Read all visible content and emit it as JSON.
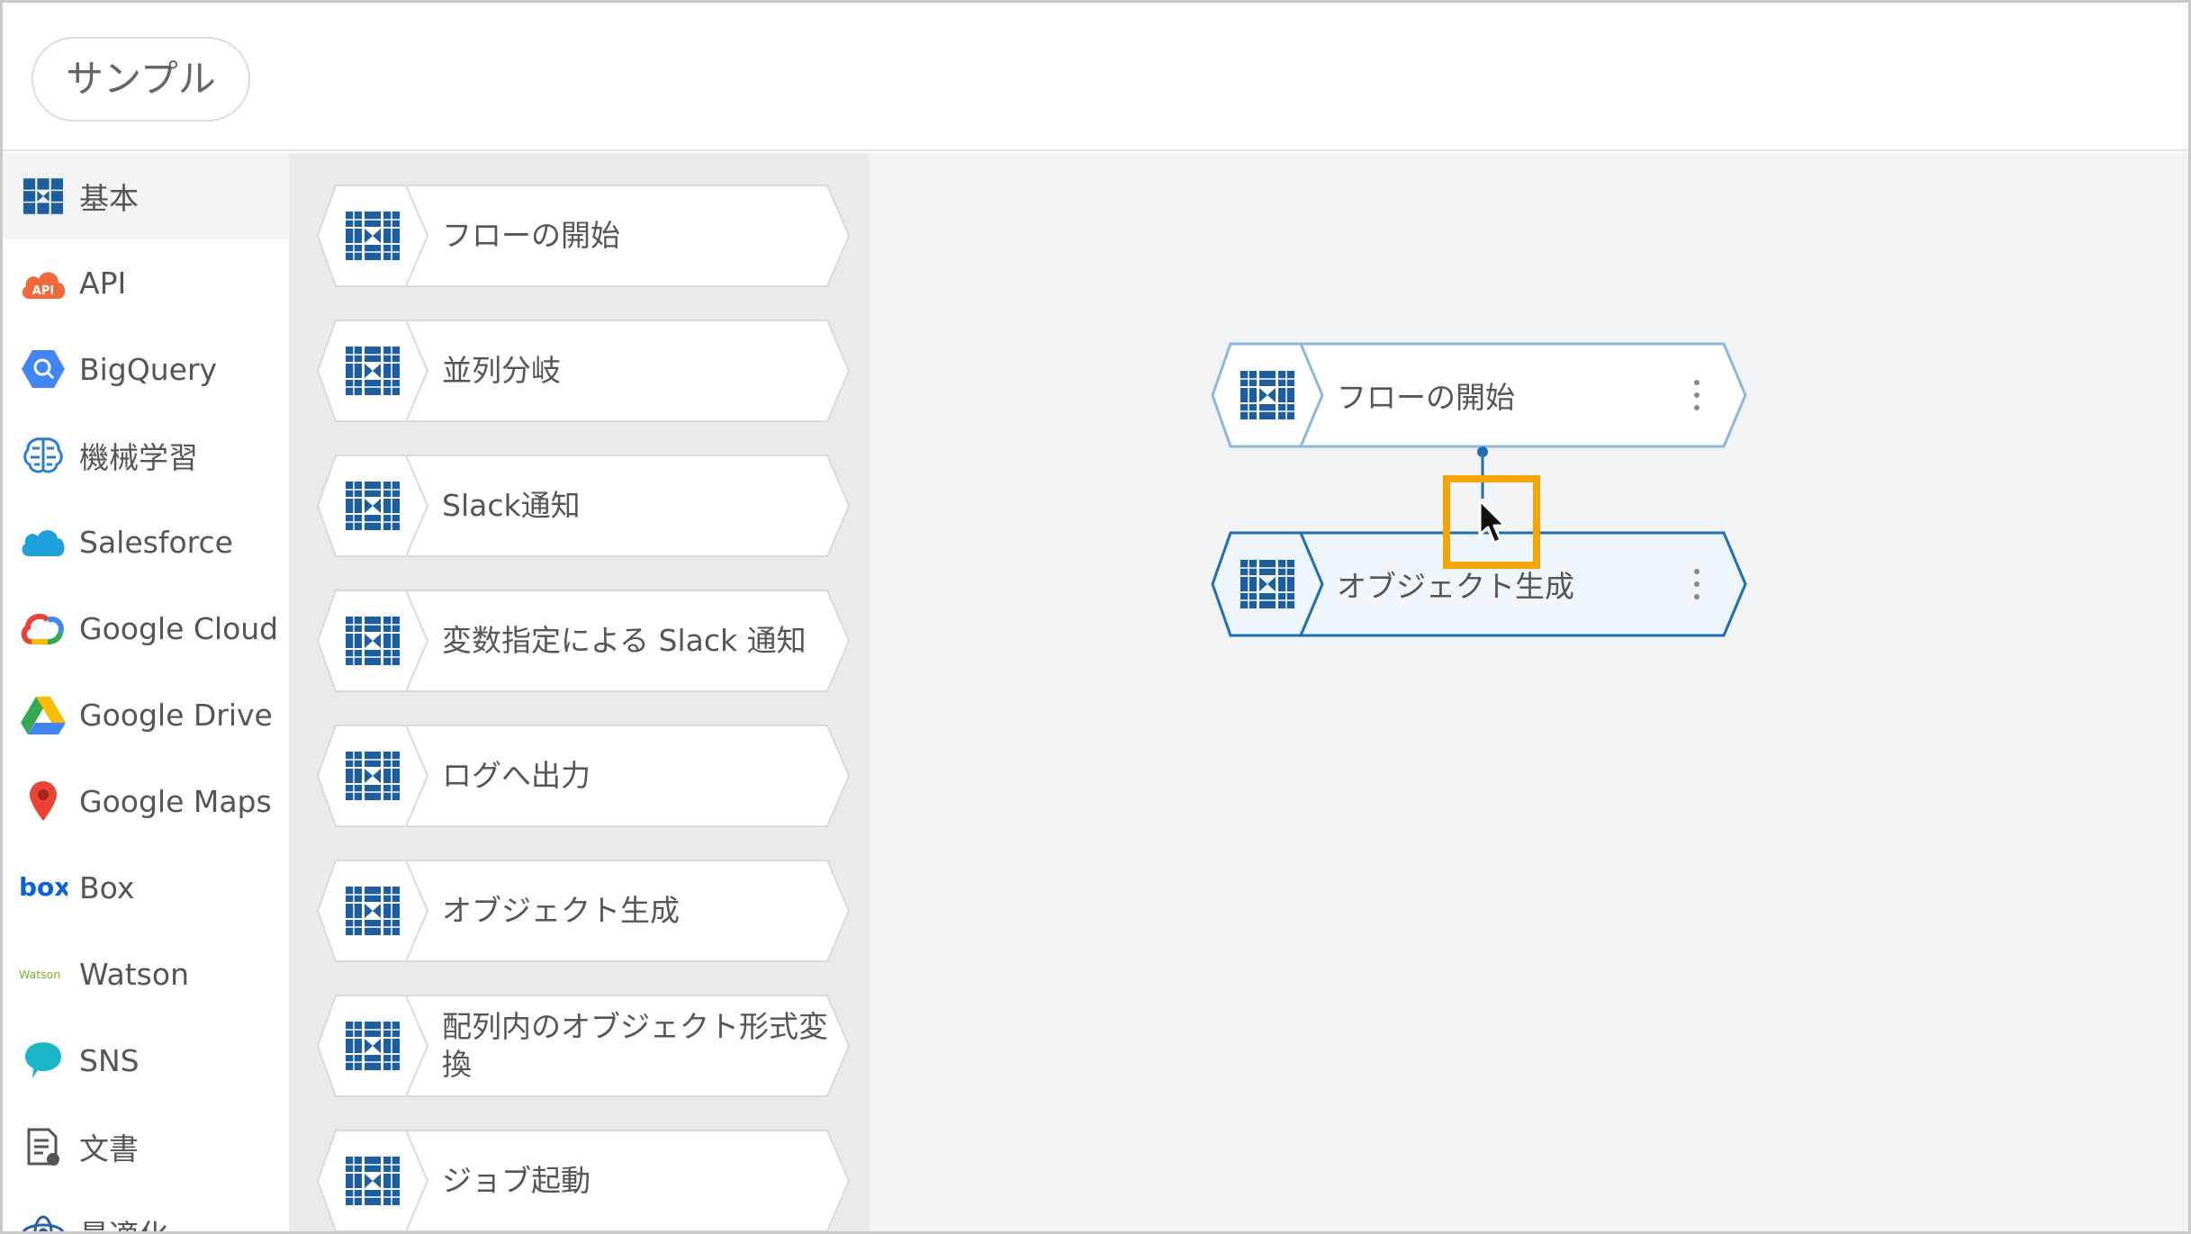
{
  "header": {
    "title": "サンプル"
  },
  "categories": [
    {
      "label": "基本",
      "icon": "blocks-icon",
      "active": true
    },
    {
      "label": "API",
      "icon": "api-cloud-icon"
    },
    {
      "label": "BigQuery",
      "icon": "bigquery-icon"
    },
    {
      "label": "機械学習",
      "icon": "brain-icon"
    },
    {
      "label": "Salesforce",
      "icon": "salesforce-cloud-icon"
    },
    {
      "label": "Google Cloud",
      "icon": "google-cloud-icon"
    },
    {
      "label": "Google Drive",
      "icon": "google-drive-icon"
    },
    {
      "label": "Google Maps",
      "icon": "map-pin-icon"
    },
    {
      "label": "Box",
      "icon": "box-logo-icon"
    },
    {
      "label": "Watson",
      "icon": "watson-logo-icon"
    },
    {
      "label": "SNS",
      "icon": "chat-bubble-icon"
    },
    {
      "label": "文書",
      "icon": "document-icon"
    },
    {
      "label": "最適化",
      "icon": "optimize-icon"
    }
  ],
  "palette": [
    {
      "label": "フローの開始"
    },
    {
      "label": "並列分岐"
    },
    {
      "label": "Slack通知"
    },
    {
      "label": "変数指定による Slack 通知"
    },
    {
      "label": "ログへ出力"
    },
    {
      "label": "オブジェクト生成"
    },
    {
      "label": "配列内のオブジェクト形式変換"
    },
    {
      "label": "ジョブ起動"
    }
  ],
  "canvas": {
    "nodes": [
      {
        "label": "フローの開始",
        "selected": false
      },
      {
        "label": "オブジェクト生成",
        "selected": true
      }
    ]
  },
  "colors": {
    "brand_blue": "#1d5f9e",
    "node_border": "#8fb7dc",
    "node_selected_border": "#1f6fb2",
    "highlight": "#f5a400"
  }
}
